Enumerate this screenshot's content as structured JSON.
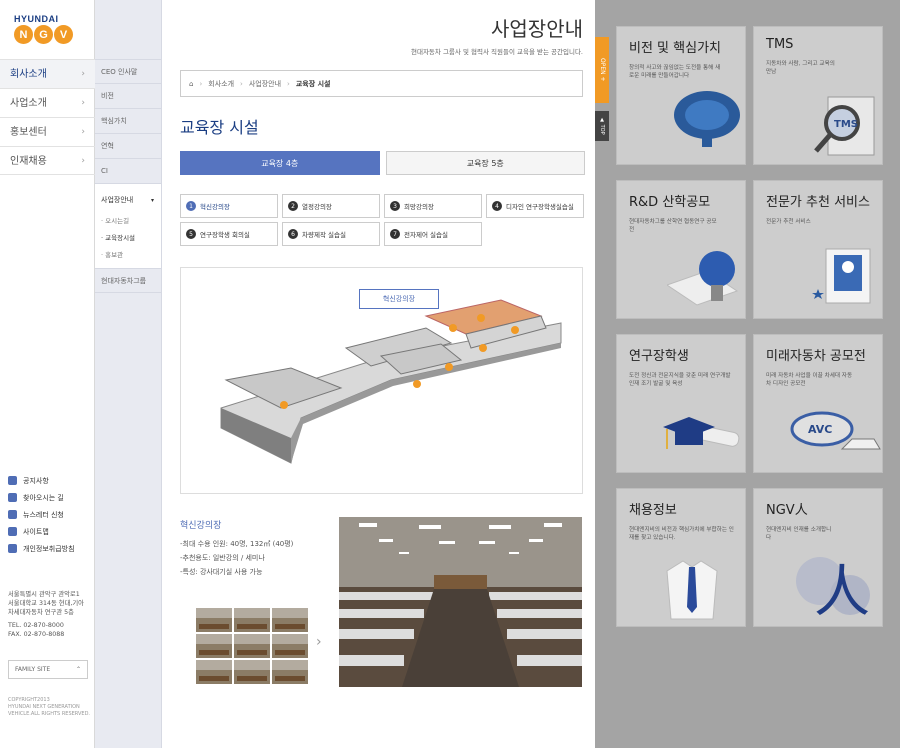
{
  "logo": {
    "brand": "HYUNDAI",
    "letters": [
      "N",
      "G",
      "V"
    ]
  },
  "gnb": [
    {
      "label": "회사소개",
      "on": true
    },
    {
      "label": "사업소개"
    },
    {
      "label": "홍보센터"
    },
    {
      "label": "인재채용"
    }
  ],
  "gnb_chev": "›",
  "quick": [
    {
      "label": "공지사항",
      "icon": "notice-icon"
    },
    {
      "label": "찾아오시는 길",
      "icon": "location-icon"
    },
    {
      "label": "뉴스레터 신청",
      "icon": "mail-icon"
    },
    {
      "label": "사이트맵",
      "icon": "sitemap-icon"
    },
    {
      "label": "개인정보취급방침",
      "icon": "privacy-icon"
    }
  ],
  "address": {
    "line1": "서울특별시 관악구 관악로1",
    "line2": "서울대학교 314동 현대,기아",
    "line3": "차세대자동차 연구관 5층",
    "tel": "TEL. 02-870-8000",
    "fax": "FAX. 02-870-8088"
  },
  "family": {
    "label": "FAMILY SITE",
    "caret": "⌃"
  },
  "copyright": {
    "l1": "COPYRIGHT2013",
    "l2": "HYUNDAI NEXT GENERATION",
    "l3": "VEHICLE.ALL RIGHTS RESERVED."
  },
  "sub": {
    "items": [
      "CEO 인사말",
      "비전",
      "핵심가치",
      "연혁",
      "CI"
    ],
    "active": "사업장안내",
    "active_caret": "▾",
    "third": [
      "· 오시는길",
      "· 교육장시설",
      "· 홍보관"
    ],
    "last": "현대자동차그룹"
  },
  "page": {
    "title": "사업장안내",
    "desc": "현대자동차 그룹사 및 협력사 직원들이 교육을 받는 공간입니다.",
    "breadcrumb": [
      "회사소개",
      "사업장안내",
      "교육장 시설"
    ],
    "home_icon": "⌂",
    "sep": "›",
    "h2": "교육장 시설"
  },
  "tabs": [
    {
      "label": "교육장 4층",
      "on": true
    },
    {
      "label": "교육장 5층"
    }
  ],
  "rooms": [
    {
      "n": "1",
      "label": "혁신강의장",
      "on": true
    },
    {
      "n": "2",
      "label": "열정강의장"
    },
    {
      "n": "3",
      "label": "희망강의장"
    },
    {
      "n": "4",
      "label": "디자인 연구장학생실습실"
    },
    {
      "n": "5",
      "label": "연구장학생 회의실"
    },
    {
      "n": "6",
      "label": "차량제작 실습실"
    },
    {
      "n": "7",
      "label": "전자제어 실습실"
    }
  ],
  "plan_label": "혁신강의장",
  "room_detail": {
    "title": "혁신강의장",
    "l1": "-최대 수용 인원: 40명, 132㎡ (40평)",
    "l2": "-추천용도: 일반강의 / 세미나",
    "l3": "-특성: 강사대기실 사용 가능"
  },
  "next_arrow": "›",
  "side_tabs": {
    "open": "OPEN +",
    "top": "▲ TOP"
  },
  "cards": [
    {
      "title": "비전 및 핵심가치",
      "desc": "창의적 사고와 끊임없는 도전을 통해 새로운 미래를 만들어갑니다",
      "icon": "brain-icon"
    },
    {
      "title": "TMS",
      "desc": "지동차와 사람, 그리고 교육의 만남",
      "icon": "tms-magnifier-icon"
    },
    {
      "title": "R&D 산학공모",
      "desc": "현대자동차그룹 산학연 협동연구 공모전",
      "icon": "lightbulb-icon"
    },
    {
      "title": "전문가 추천 서비스",
      "desc": "전문가 추천 서비스",
      "icon": "expert-frame-icon"
    },
    {
      "title": "연구장학생",
      "desc": "도전 정신과 전문지식을 갖춘 미래 연구개발 인재 조기 발굴 및 육성",
      "icon": "graduation-cap-icon"
    },
    {
      "title": "미래자동차 공모전",
      "desc": "미래 자동차 사업을 이끌 차세대 자동차 디자인 공모전",
      "icon": "avc-car-icon"
    },
    {
      "title": "채용정보",
      "desc": "현대엔지비의 비전과 핵심가치에 부합하는 인재를 찾고 있습니다.",
      "icon": "shirt-tie-icon"
    },
    {
      "title": "NGV人",
      "desc": "현대엔지비 인재를 소개합니다",
      "icon": "person-char-icon"
    }
  ],
  "tms_text": "TMS",
  "avc_text": "AVC",
  "person_char": "人"
}
